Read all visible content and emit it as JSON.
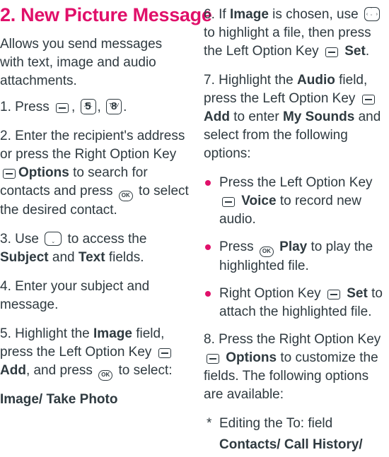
{
  "title": "2. New Picture Message",
  "intro": "Allows you send messages with text, image and audio attachments.",
  "step1": {
    "prefix": "1. Press",
    "keys": [
      {
        "big": "5",
        "small": "JKL"
      },
      {
        "big": "8",
        "small": "TUV"
      }
    ]
  },
  "step2": {
    "part1": "2. Enter the recipient's address or press the Right Option Key",
    "options": "Options",
    "part2": "to search for contacts and press",
    "part3": "to select the desired contact."
  },
  "step3": {
    "part1": "3. Use",
    "part2": "to access the",
    "subject": "Subject",
    "and": "and",
    "text": "Text",
    "part3": "fields."
  },
  "step4": "4. Enter your subject and message.",
  "step5": {
    "part1": "5. Highlight the",
    "image": "Image",
    "part2": "field, press the Left Option Key",
    "add": "Add",
    "part3": ", and press",
    "part4": "to select:"
  },
  "step5_options": "Image/ Take Photo",
  "step6": {
    "part1": "6. If",
    "image": "Image",
    "part2": "is chosen, use",
    "part3": "to highlight a file, then press the Left Option Key",
    "set": "Set",
    "part4": "."
  },
  "step7": {
    "part1": "7. Highlight the",
    "audio": "Audio",
    "part2": "field, press the Left Option Key",
    "add": "Add",
    "part3": "to enter",
    "mysounds": "My Sounds",
    "part4": "and select from the following options:"
  },
  "bullets": [
    {
      "pre": "Press the Left Option Key",
      "key": "soft",
      "bold": "Voice",
      "post": "to record new audio."
    },
    {
      "pre": "Press",
      "key": "ok",
      "bold": "Play",
      "post": "to play the highlighted file."
    },
    {
      "pre": "Right Option Key",
      "key": "soft",
      "bold": "Set",
      "post": "to attach the highlighted file."
    }
  ],
  "step8": {
    "part1": "8. Press the Right Option Key",
    "options": "Options",
    "part2": "to customize the fields. The following options are available:"
  },
  "note": {
    "star": "*",
    "text": "Editing the To: field",
    "options": "Contacts/ Call History/"
  },
  "ok_label": "OK",
  "colors": {
    "accent": "#e0106a",
    "text": "#2f3a40"
  }
}
